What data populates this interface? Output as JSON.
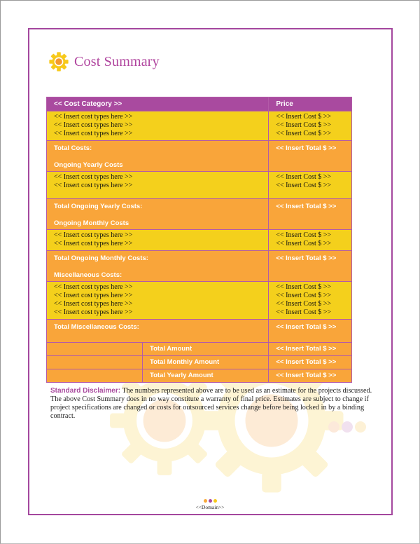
{
  "document": {
    "title": "Cost Summary",
    "title_icon": "gear-icon",
    "colors": {
      "accent_purple": "#a94a9f",
      "title_magenta": "#b0449e",
      "row_yellow": "#f4d01c",
      "row_orange": "#f9a53a",
      "gear_yellow": "#f7c91a",
      "gear_center_orange": "#f59a2c"
    }
  },
  "table": {
    "headers": [
      "<< Cost Category >>",
      "Price"
    ],
    "groups": [
      {
        "items": [
          "<< Insert cost types here >>",
          "<< Insert cost types here >>",
          "<< Insert cost types here >>"
        ],
        "prices": [
          "<< Insert Cost $ >>",
          "<< Insert Cost $ >>",
          "<< Insert Cost $ >>"
        ],
        "total_label": "Total Costs:",
        "next_section": "Ongoing Yearly Costs",
        "total_value": "<< Insert Total $ >>"
      },
      {
        "items": [
          "<< Insert cost types here >>",
          "<< Insert cost types here >>"
        ],
        "prices": [
          "<< Insert Cost $ >>",
          "<< Insert Cost $ >>"
        ],
        "total_label": "Total Ongoing Yearly Costs:",
        "next_section": "Ongoing Monthly Costs",
        "total_value": "<< Insert Total $ >>"
      },
      {
        "items": [
          "<< Insert cost types here >>",
          "<< Insert cost types here >>"
        ],
        "prices": [
          "<< Insert Cost $ >>",
          "<< Insert Cost $ >>"
        ],
        "total_label": "Total Ongoing Monthly Costs:",
        "next_section": "Miscellaneous Costs:",
        "total_value": "<< Insert Total $ >>"
      },
      {
        "items": [
          "<< Insert cost types here >>",
          "<< Insert cost types here >>",
          "<< Insert cost types here >>",
          "<< Insert cost types here >>"
        ],
        "prices": [
          "<< Insert Cost $ >>",
          "<< Insert Cost $ >>",
          "<< Insert Cost $ >>",
          "<< Insert Cost $ >>"
        ],
        "total_label": "Total Miscellaneous Costs:",
        "next_section": "",
        "total_value": "<< Insert Total $ >>"
      }
    ],
    "summary": [
      {
        "label": "Total Amount",
        "value": "<< Insert Total $ >>"
      },
      {
        "label": "Total Monthly Amount",
        "value": "<< Insert Total $ >>"
      },
      {
        "label": "Total Yearly Amount",
        "value": "<< Insert Total $ >>"
      }
    ]
  },
  "disclaimer": {
    "label": "Standard Disclaimer:",
    "text": " The numbers represented above are to be used as an estimate for the projects discussed. The above Cost Summary does in no way constitute a warranty of final price.  Estimates are subject to change if project specifications are changed or costs for outsourced services change before being locked in by a binding contract."
  },
  "footer": {
    "domain": "<<Domain>>",
    "dot_colors": [
      "#f7a93a",
      "#a94a9f",
      "#f7c91a"
    ]
  }
}
